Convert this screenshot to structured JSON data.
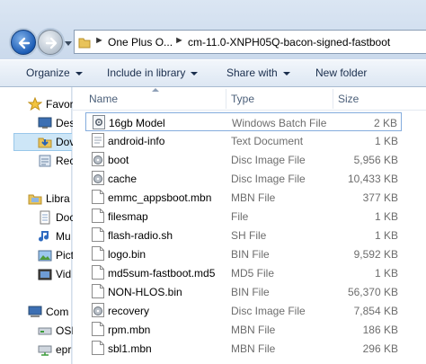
{
  "address": {
    "crumbs": [
      "One Plus O...",
      "cm-11.0-XNPH05Q-bacon-signed-fastboot"
    ]
  },
  "toolbar": {
    "organize": "Organize",
    "include": "Include in library",
    "share": "Share with",
    "new_folder": "New folder"
  },
  "nav": {
    "favorites": "Favor",
    "desktop": "Des",
    "downloads": "Dov",
    "recent": "Rec",
    "libraries": "Libra",
    "documents": "Doc",
    "music": "Mu",
    "pictures": "Pict",
    "videos": "Vid",
    "computer": "Com",
    "os": "OSI",
    "epr": "epr"
  },
  "columns": {
    "name": "Name",
    "type": "Type",
    "size": "Size"
  },
  "files": [
    {
      "name": "16gb Model",
      "type": "Windows Batch File",
      "size": "2 KB",
      "icon": "batch-file-icon"
    },
    {
      "name": "android-info",
      "type": "Text Document",
      "size": "1 KB",
      "icon": "text-file-icon"
    },
    {
      "name": "boot",
      "type": "Disc Image File",
      "size": "5,956 KB",
      "icon": "disc-image-icon"
    },
    {
      "name": "cache",
      "type": "Disc Image File",
      "size": "10,433 KB",
      "icon": "disc-image-icon"
    },
    {
      "name": "emmc_appsboot.mbn",
      "type": "MBN File",
      "size": "377 KB",
      "icon": "file-icon"
    },
    {
      "name": "filesmap",
      "type": "File",
      "size": "1 KB",
      "icon": "file-icon"
    },
    {
      "name": "flash-radio.sh",
      "type": "SH File",
      "size": "1 KB",
      "icon": "file-icon"
    },
    {
      "name": "logo.bin",
      "type": "BIN File",
      "size": "9,592 KB",
      "icon": "file-icon"
    },
    {
      "name": "md5sum-fastboot.md5",
      "type": "MD5 File",
      "size": "1 KB",
      "icon": "file-icon"
    },
    {
      "name": "NON-HLOS.bin",
      "type": "BIN File",
      "size": "56,370 KB",
      "icon": "file-icon"
    },
    {
      "name": "recovery",
      "type": "Disc Image File",
      "size": "7,854 KB",
      "icon": "disc-image-icon"
    },
    {
      "name": "rpm.mbn",
      "type": "MBN File",
      "size": "186 KB",
      "icon": "file-icon"
    },
    {
      "name": "sbl1.mbn",
      "type": "MBN File",
      "size": "296 KB",
      "icon": "file-icon"
    }
  ]
}
